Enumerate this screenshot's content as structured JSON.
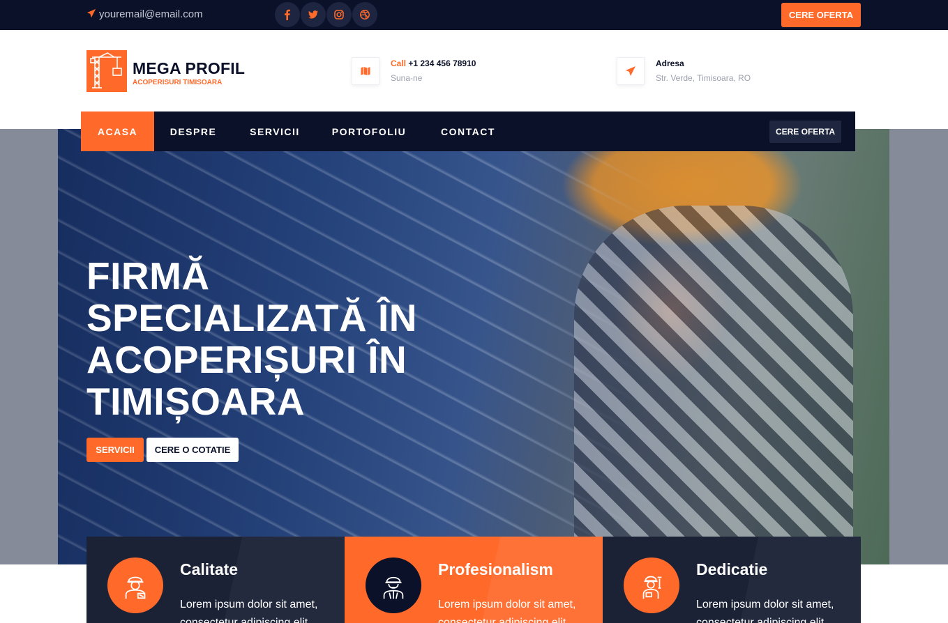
{
  "topbar": {
    "email": "youremail@email.com",
    "socials": [
      "facebook-icon",
      "twitter-icon",
      "instagram-icon",
      "dribbble-icon"
    ],
    "cta_label": "CERE OFERTA"
  },
  "header": {
    "brand_name": "MEGA PROFIL",
    "brand_tagline": "ACOPERISURI TIMISOARA",
    "contact": {
      "label_accent": "Call",
      "phone": "+1 234 456 78910",
      "sub": "Suna-ne"
    },
    "address": {
      "label": "Adresa",
      "value": "Str. Verde, Timisoara, RO"
    }
  },
  "nav": {
    "items": [
      {
        "label": "ACASA",
        "active": true
      },
      {
        "label": "DESPRE",
        "active": false
      },
      {
        "label": "SERVICII",
        "active": false
      },
      {
        "label": "PORTOFOLIU",
        "active": false
      },
      {
        "label": "CONTACT",
        "active": false
      }
    ],
    "cta_label": "CERE OFERTA"
  },
  "hero": {
    "title_lines": [
      "FIRMĂ",
      "SPECIALIZATĂ ÎN",
      "ACOPERIȘURI ÎN",
      "TIMIȘOARA"
    ],
    "primary_button": "SERVICII",
    "secondary_button": "CERE O COTATIE"
  },
  "features": [
    {
      "title": "Calitate",
      "text": "Lorem ipsum dolor sit amet, consectetur adipiscing elit",
      "style": "dark",
      "icon": "worker-tools-icon"
    },
    {
      "title": "Profesionalism",
      "text": "Lorem ipsum dolor sit amet, consectetur adipiscing elit",
      "style": "orange",
      "icon": "engineer-helmet-icon"
    },
    {
      "title": "Dedicatie",
      "text": "Lorem ipsum dolor sit amet, consectetur adipiscing elit",
      "style": "dark",
      "icon": "worker-wrench-icon"
    }
  ],
  "colors": {
    "accent": "#ff6a2b",
    "dark": "#0b1129",
    "card_dark": "#1b2236"
  }
}
